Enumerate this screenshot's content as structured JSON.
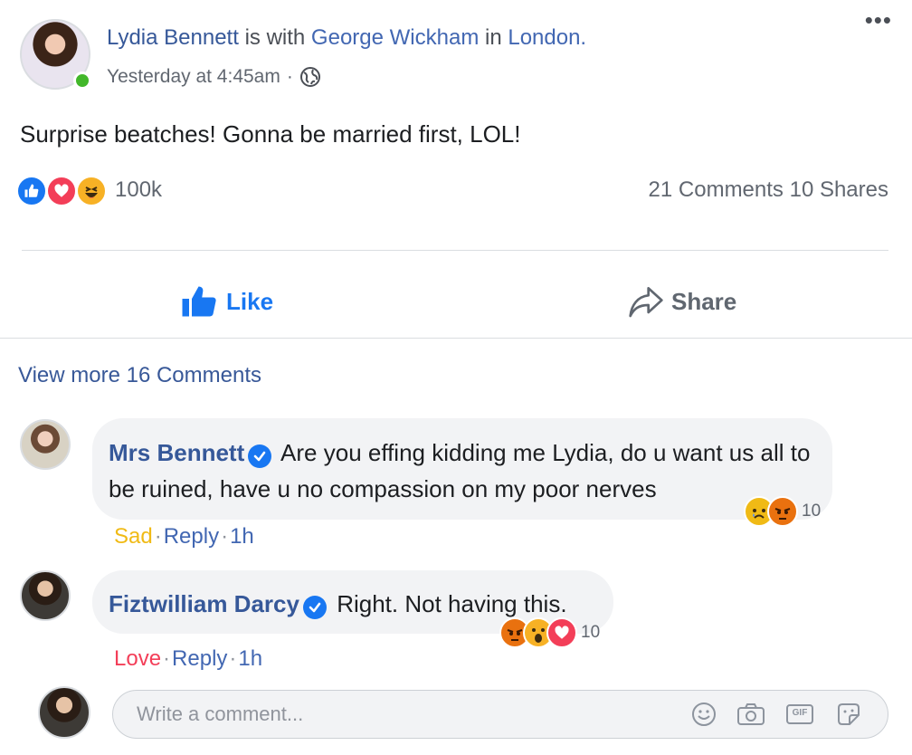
{
  "post": {
    "author": "Lydia Bennett",
    "with_text": "is with",
    "tagged": "George Wickham",
    "in_text": "in",
    "location": "London.",
    "timestamp": "Yesterday at 4:45am",
    "separator": "·",
    "audience_icon": "globe-icon",
    "more_icon": "more-dots-icon",
    "more_glyph": "•••",
    "text": "Surprise beatches! Gonna be married first, LOL!",
    "reactions": {
      "icons": [
        "like-icon",
        "love-icon",
        "haha-icon"
      ],
      "count": "100k"
    },
    "comments_shares": "21 Comments 10 Shares"
  },
  "actions": {
    "like_label": "Like",
    "share_label": "Share"
  },
  "view_more": "View more 16 Comments",
  "comments": [
    {
      "author": "Mrs Bennett",
      "text": "Are you effing kidding me Lydia, do u want us all to be ruined, have u no compassion on my poor nerves",
      "reaction_icons": [
        "sad-icon",
        "angry-icon"
      ],
      "reaction_count": "10",
      "my_reaction": "Sad",
      "reply": "Reply",
      "time": "1h"
    },
    {
      "author": "Fiztwilliam Darcy",
      "text": "Right. Not having this.",
      "reaction_icons": [
        "angry-icon",
        "wow-icon",
        "love-icon"
      ],
      "reaction_count": "10",
      "my_reaction": "Love",
      "reply": "Reply",
      "time": "1h"
    }
  ],
  "composer": {
    "placeholder": "Write a comment...",
    "tools": [
      "emoji-icon",
      "camera-icon",
      "gif-icon",
      "sticker-icon"
    ],
    "gif_label": "GIF"
  },
  "colors": {
    "link_blue": "#4267b2",
    "like_blue": "#1877f2",
    "love_red": "#f33e58",
    "haha_yellow": "#f7b125",
    "sad_yellow": "#f0ba15",
    "angry_orange": "#e9710f",
    "bubble_grey": "#f2f3f5",
    "online_green": "#42b72a"
  }
}
